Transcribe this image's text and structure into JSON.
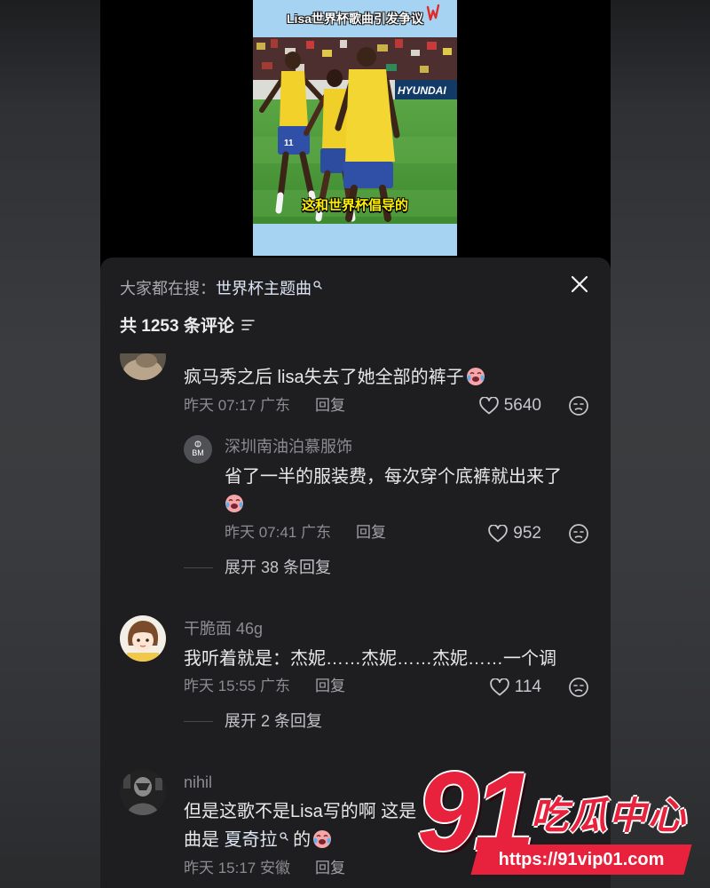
{
  "video": {
    "title": "Lisa世界杯歌曲引发争议",
    "subtitle": "这和世界杯倡导的",
    "ad_board": "HYUNDAI",
    "jersey_number": "11"
  },
  "search_bar": {
    "prefix": "大家都在搜：",
    "term": "世界杯主题曲",
    "icon": "search-icon"
  },
  "header": {
    "comment_count": "共 1253 条评论",
    "filter_icon": "filter-icon",
    "close_icon": "close-icon"
  },
  "comments": [
    {
      "text": "疯马秀之后 lisa失去了她全部的裤子",
      "time_location": "昨天 07:17 广东",
      "reply_label": "回复",
      "likes": "5640",
      "replies": [
        {
          "author": "深圳南油泊慕服饰",
          "avatar_text": "BM",
          "text": "省了一半的服装费，每次穿个底裤就出来了",
          "time_location": "昨天 07:41 广东",
          "reply_label": "回复",
          "likes": "952"
        }
      ],
      "expand_label": "展开 38 条回复"
    },
    {
      "author": "干脆面 46g",
      "text": "我听着就是：杰妮……杰妮……杰妮……一个调",
      "time_location": "昨天 15:55 广东",
      "reply_label": "回复",
      "likes": "114",
      "expand_label": "展开 2 条回复"
    },
    {
      "author": "nihil",
      "text_line1": "但是这歌不是Lisa写的啊 这是",
      "text_line2_prefix": "曲是 ",
      "text_line2_link": "夏奇拉",
      "text_line2_suffix": " 的",
      "time_location": "昨天 15:17 安徽",
      "reply_label": "回复"
    }
  ],
  "watermark": {
    "number": "91",
    "name": "吃瓜中心",
    "url": "https://91vip01.com"
  },
  "colors": {
    "panel_bg": "#1e1e20",
    "primary_text": "#e8e8ea",
    "secondary_text": "#8c8c91",
    "link_text": "#dde6f5",
    "watermark_red": "#e8213c",
    "video_bg": "#a7d3f2"
  }
}
